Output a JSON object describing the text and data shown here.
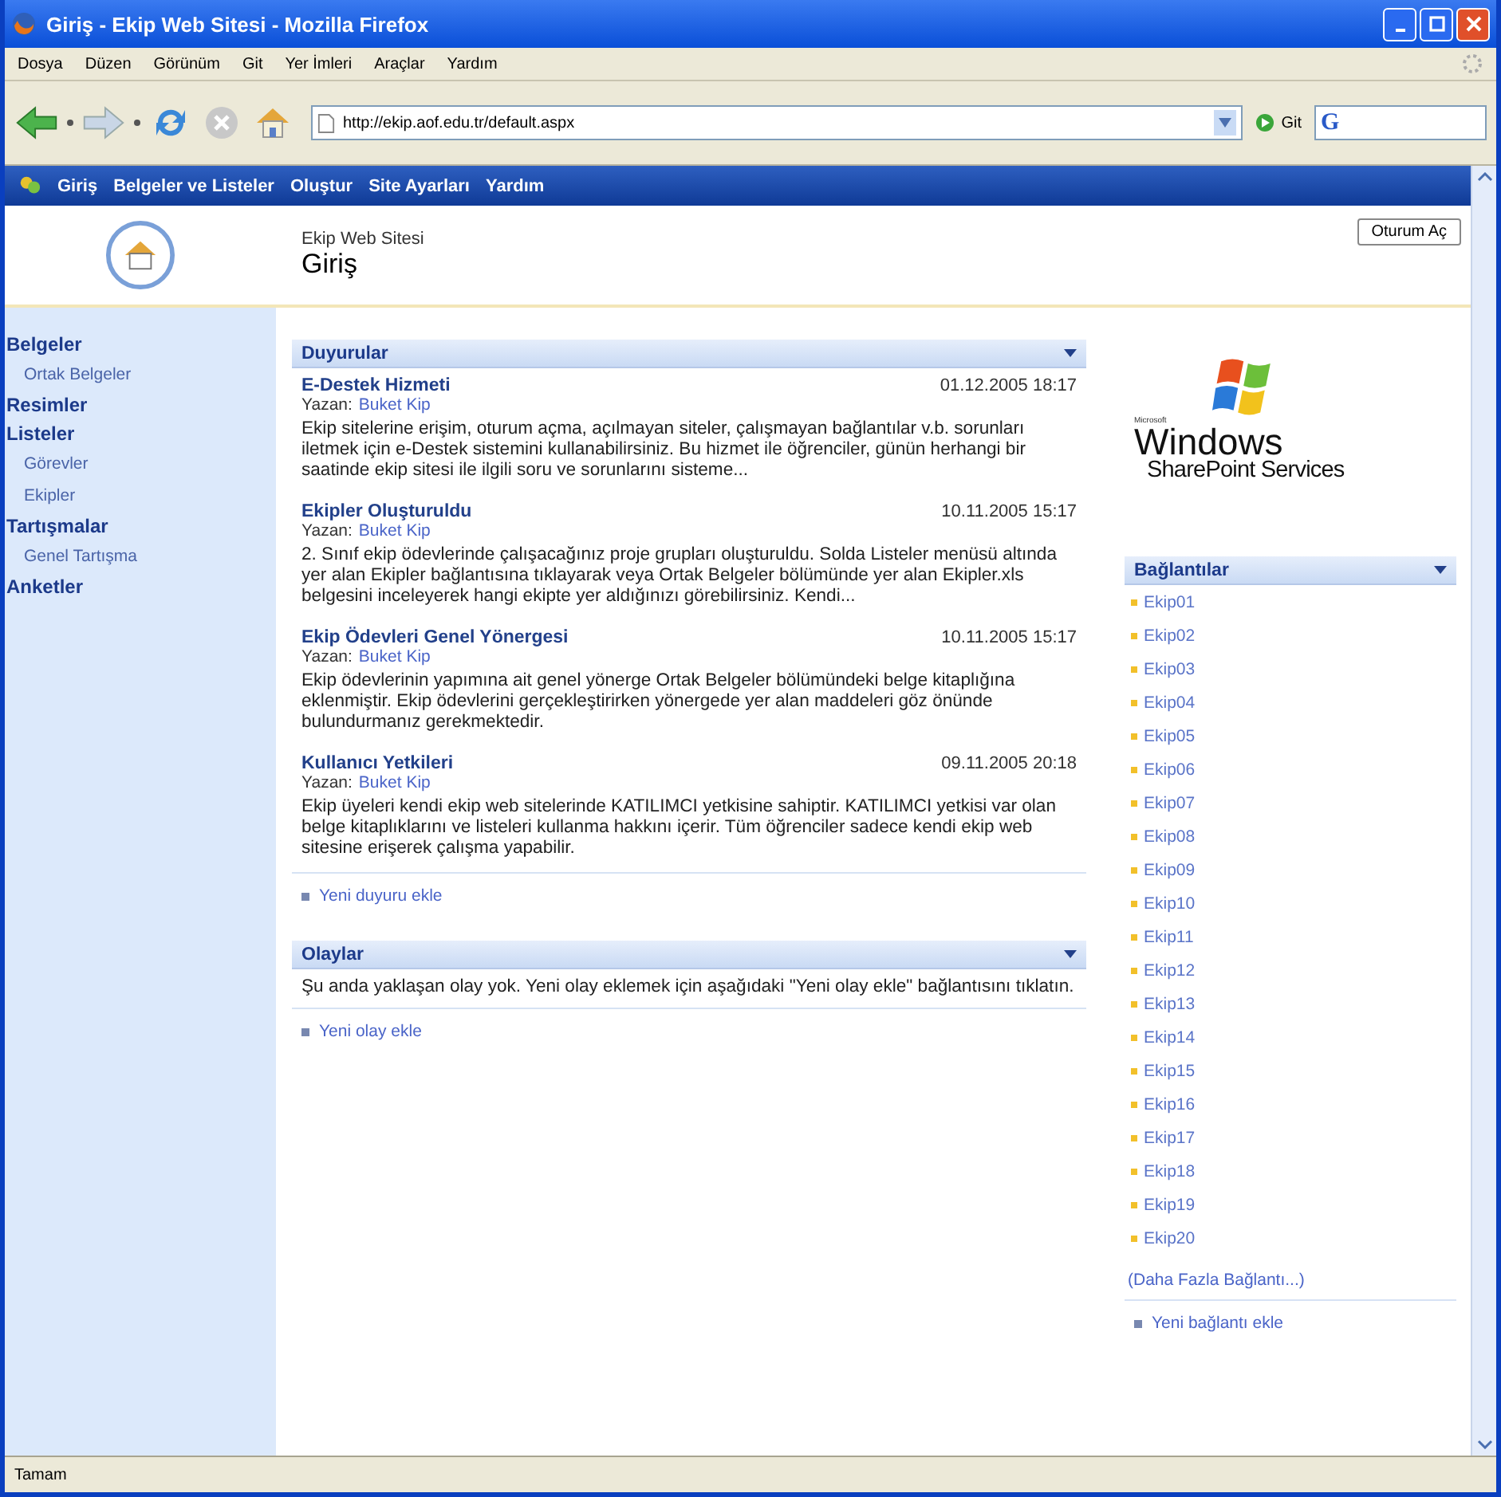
{
  "window": {
    "title": "Giriş - Ekip Web Sitesi  -  Mozilla Firefox"
  },
  "menu": [
    "Dosya",
    "Düzen",
    "Görünüm",
    "Git",
    "Yer İmleri",
    "Araçlar",
    "Yardım"
  ],
  "toolbar": {
    "address": "http://ekip.aof.edu.tr/default.aspx",
    "go_label": "Git",
    "search_logo": "G"
  },
  "site_nav": [
    "Giriş",
    "Belgeler ve Listeler",
    "Oluştur",
    "Site Ayarları",
    "Yardım"
  ],
  "header": {
    "site_name": "Ekip Web Sitesi",
    "page_title": "Giriş",
    "sign_in": "Oturum Aç"
  },
  "quick_launch": [
    {
      "label": "Belgeler",
      "children": [
        {
          "label": "Ortak Belgeler"
        }
      ]
    },
    {
      "label": "Resimler"
    },
    {
      "label": "Listeler",
      "children": [
        {
          "label": "Görevler"
        },
        {
          "label": "Ekipler"
        }
      ]
    },
    {
      "label": "Tartışmalar",
      "children": [
        {
          "label": "Genel Tartışma"
        }
      ]
    },
    {
      "label": "Anketler"
    }
  ],
  "announcements": {
    "title": "Duyurular",
    "items": [
      {
        "title": "E-Destek Hizmeti",
        "date": "01.12.2005 18:17",
        "author_label": "Yazan:",
        "author": "Buket Kip",
        "body": "Ekip sitelerine erişim, oturum açma, açılmayan siteler, çalışmayan bağlantılar v.b. sorunları iletmek için e-Destek sistemini kullanabilirsiniz. Bu hizmet ile öğrenciler, günün herhangi bir saatinde ekip sitesi ile ilgili soru ve sorunlarını sisteme..."
      },
      {
        "title": "Ekipler Oluşturuldu",
        "date": "10.11.2005 15:17",
        "author_label": "Yazan:",
        "author": "Buket Kip",
        "body": "2. Sınıf ekip ödevlerinde çalışacağınız proje grupları oluşturuldu. Solda Listeler menüsü altında yer alan Ekipler bağlantısına tıklayarak veya Ortak Belgeler bölümünde yer alan Ekipler.xls belgesini inceleyerek hangi ekipte yer aldığınızı görebilirsiniz. Kendi..."
      },
      {
        "title": "Ekip Ödevleri Genel Yönergesi",
        "date": "10.11.2005 15:17",
        "author_label": "Yazan:",
        "author": "Buket Kip",
        "body": "Ekip ödevlerinin yapımına ait genel yönerge Ortak Belgeler bölümündeki belge kitaplığına eklenmiştir. Ekip ödevlerini gerçekleştirirken yönergede yer alan maddeleri göz önünde bulundurmanız gerekmektedir."
      },
      {
        "title": "Kullanıcı Yetkileri",
        "date": "09.11.2005 20:18",
        "author_label": "Yazan:",
        "author": "Buket Kip",
        "body": "Ekip üyeleri kendi ekip web sitelerinde KATILIMCI yetkisine sahiptir. KATILIMCI yetkisi var olan belge kitaplıklarını ve listeleri kullanma hakkını içerir. Tüm öğrenciler sadece kendi ekip web sitesine erişerek çalışma yapabilir."
      }
    ],
    "add_link": "Yeni duyuru ekle"
  },
  "events": {
    "title": "Olaylar",
    "body": "Şu anda yaklaşan olay yok. Yeni olay eklemek için aşağıdaki \"Yeni olay ekle\" bağlantısını tıklatın.",
    "add_link": "Yeni olay ekle"
  },
  "logo": {
    "maker": "Microsoft",
    "line1": "Windows",
    "line2": "SharePoint Services"
  },
  "links": {
    "title": "Bağlantılar",
    "items": [
      "Ekip01",
      "Ekip02",
      "Ekip03",
      "Ekip04",
      "Ekip05",
      "Ekip06",
      "Ekip07",
      "Ekip08",
      "Ekip09",
      "Ekip10",
      "Ekip11",
      "Ekip12",
      "Ekip13",
      "Ekip14",
      "Ekip15",
      "Ekip16",
      "Ekip17",
      "Ekip18",
      "Ekip19",
      "Ekip20"
    ],
    "more": "(Daha Fazla Bağlantı...)",
    "add_link": "Yeni bağlantı ekle"
  },
  "status_bar": "Tamam"
}
